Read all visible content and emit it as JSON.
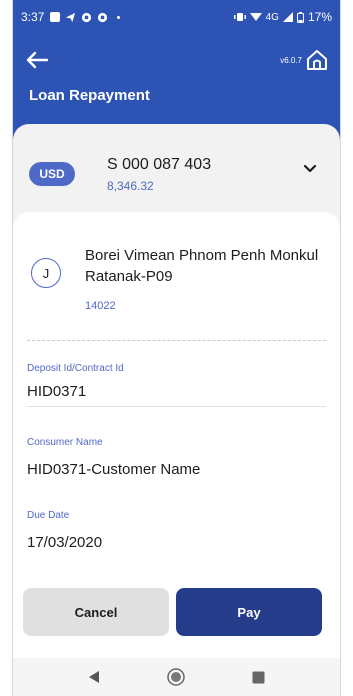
{
  "status_bar": {
    "time": "3:37",
    "network": "4G",
    "battery": "17%"
  },
  "app_bar": {
    "version": "v6.0.7",
    "title": "Loan Repayment"
  },
  "account": {
    "currency": "USD",
    "number": "S 000 087 403",
    "balance": "8,346.32"
  },
  "customer": {
    "avatar_initial": "J",
    "name": "Borei Vimean Phnom Penh Monkul Ratanak-P09",
    "code": "14022"
  },
  "fields": [
    {
      "label": "Deposit Id/Contract Id",
      "value": "HID0371"
    },
    {
      "label": "Consumer Name",
      "value": "HID0371-Customer Name"
    },
    {
      "label": "Due Date",
      "value": "17/03/2020"
    }
  ],
  "actions": {
    "cancel_label": "Cancel",
    "pay_label": "Pay"
  },
  "colors": {
    "header_blue": "#2d54b5",
    "accent_blue": "#4f69c6",
    "pay_button": "#253c8a",
    "cancel_button": "#e0e0e0"
  },
  "icons": {
    "back": "arrow-left-icon",
    "home": "home-icon",
    "dropdown": "chevron-down-icon",
    "nav_back": "triangle-back-icon",
    "nav_home": "circle-home-icon",
    "nav_recents": "square-recents-icon"
  }
}
